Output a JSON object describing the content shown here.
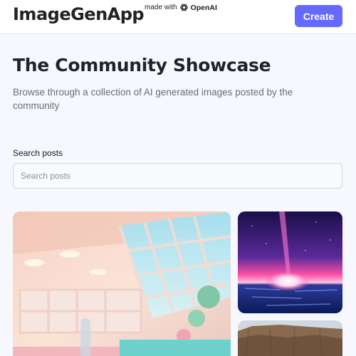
{
  "header": {
    "logo_text": "ImageGenApp",
    "made_with_text": "made with",
    "openai_text": "OpenAI",
    "create_label": "Create"
  },
  "main": {
    "title": "The Community Showcase",
    "subtitle": "Browse through a collection of AI generated images posted by the community"
  },
  "search": {
    "label": "Search posts",
    "placeholder": "Search posts",
    "value": ""
  },
  "gallery": {
    "cards": [
      {
        "icon": "interior-pool-image"
      },
      {
        "icon": "ocean-sunset-image"
      },
      {
        "icon": "desert-mesa-image"
      }
    ]
  },
  "colors": {
    "accent": "#6469ff",
    "background": "#f7f8fd",
    "text_primary": "#222328",
    "text_secondary": "#666e75"
  }
}
